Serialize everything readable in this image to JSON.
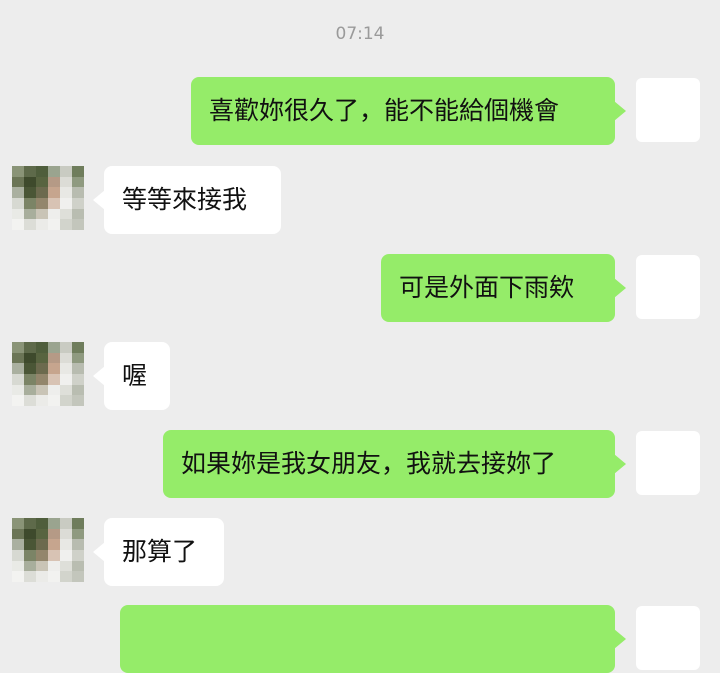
{
  "chat": {
    "timestamp": "07:14",
    "messages": [
      {
        "from": "me",
        "text": "喜歡妳很久了，能不能給個機會"
      },
      {
        "from": "them",
        "text": "等等來接我"
      },
      {
        "from": "me",
        "text": "可是外面下雨欸"
      },
      {
        "from": "them",
        "text": "喔"
      },
      {
        "from": "me",
        "text": "如果妳是我女朋友，我就去接妳了"
      },
      {
        "from": "them",
        "text": "那算了"
      },
      {
        "from": "me",
        "text": ""
      }
    ]
  },
  "colors": {
    "background": "#ededed",
    "my_bubble": "#95ec69",
    "their_bubble": "#ffffff",
    "timestamp_text": "#9a9a9a"
  },
  "icons": {
    "self_avatar": "blank-avatar-icon",
    "contact_avatar": "pixelated-avatar-icon"
  }
}
